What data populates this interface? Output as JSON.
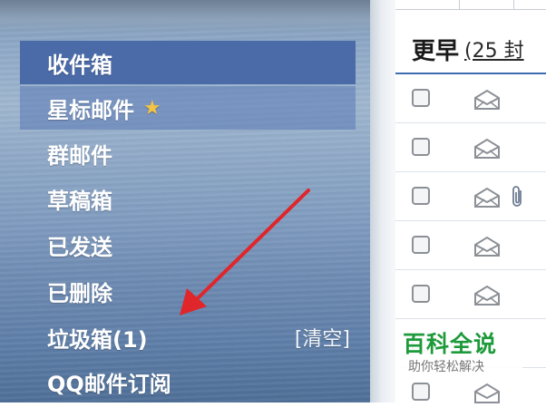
{
  "sidebar": {
    "items": [
      {
        "label": "收件箱"
      },
      {
        "label": "星标邮件",
        "icon": "star-icon"
      },
      {
        "label": "群邮件"
      },
      {
        "label": "草稿箱"
      },
      {
        "label": "已发送"
      },
      {
        "label": "已删除"
      },
      {
        "label": "垃圾箱(1)",
        "action": "[清空]"
      },
      {
        "label": "QQ邮件订阅"
      }
    ]
  },
  "mail_list": {
    "group_title": "更早",
    "group_count": "(25 封"
  },
  "watermark": {
    "title": "百科全说",
    "subtitle": "助你轻松解决"
  },
  "colors": {
    "active_item": "#4a6aa8",
    "star": "#f5c542",
    "annotation_arrow": "#e0262b",
    "watermark_green": "#1d9a3a"
  }
}
